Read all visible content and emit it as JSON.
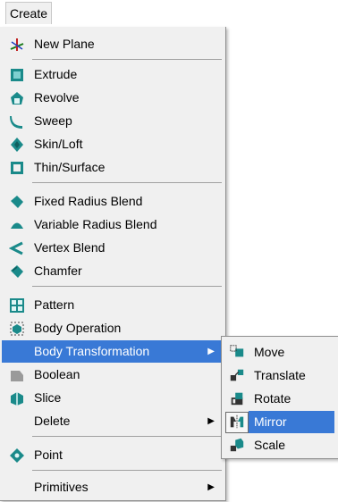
{
  "menubar": {
    "title": "Create"
  },
  "menu": {
    "items": [
      {
        "label": "New Plane",
        "icon": "new-plane-icon"
      },
      {
        "label": "Extrude",
        "icon": "extrude-icon"
      },
      {
        "label": "Revolve",
        "icon": "revolve-icon"
      },
      {
        "label": "Sweep",
        "icon": "sweep-icon"
      },
      {
        "label": "Skin/Loft",
        "icon": "skin-loft-icon"
      },
      {
        "label": "Thin/Surface",
        "icon": "thin-surface-icon"
      },
      {
        "label": "Fixed Radius Blend",
        "icon": "fixed-radius-blend-icon"
      },
      {
        "label": "Variable Radius Blend",
        "icon": "variable-radius-blend-icon"
      },
      {
        "label": "Vertex Blend",
        "icon": "vertex-blend-icon"
      },
      {
        "label": "Chamfer",
        "icon": "chamfer-icon"
      },
      {
        "label": "Pattern",
        "icon": "pattern-icon"
      },
      {
        "label": "Body Operation",
        "icon": "body-operation-icon"
      },
      {
        "label": "Body Transformation",
        "icon": "",
        "submenu": true,
        "highlighted": true
      },
      {
        "label": "Boolean",
        "icon": "boolean-icon",
        "disabled_icon": true
      },
      {
        "label": "Slice",
        "icon": "slice-icon"
      },
      {
        "label": "Delete",
        "icon": "",
        "submenu": true
      },
      {
        "label": "Point",
        "icon": "point-icon"
      },
      {
        "label": "Primitives",
        "icon": "",
        "submenu": true
      }
    ]
  },
  "submenu": {
    "items": [
      {
        "label": "Move",
        "icon": "move-icon"
      },
      {
        "label": "Translate",
        "icon": "translate-icon"
      },
      {
        "label": "Rotate",
        "icon": "rotate-icon"
      },
      {
        "label": "Mirror",
        "icon": "mirror-icon",
        "highlighted": true
      },
      {
        "label": "Scale",
        "icon": "scale-icon"
      }
    ]
  },
  "colors": {
    "highlight": "#3979d6",
    "menu_bg": "#f0f0f0",
    "icon_teal": "#1a8a8a"
  },
  "arrow_glyph": "▶"
}
